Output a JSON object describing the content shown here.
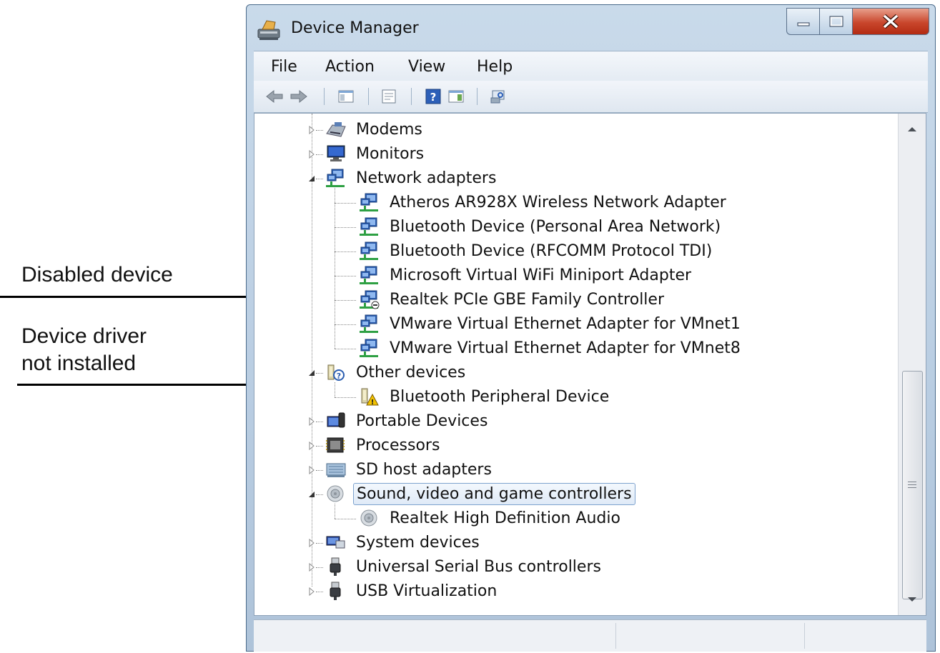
{
  "annotations": {
    "disabled_device": "Disabled device",
    "driver_not_installed": "Device driver\nnot installed"
  },
  "window": {
    "title": "Device Manager",
    "menu": [
      "File",
      "Action",
      "View",
      "Help"
    ],
    "toolbar_icons": [
      "back-icon",
      "forward-icon",
      "show-hide-console-tree-icon",
      "properties-icon",
      "help-icon",
      "action-pane-icon",
      "scan-hardware-icon"
    ]
  },
  "tree": [
    {
      "label": "Modems",
      "icon": "modem-icon",
      "expanded": false,
      "level": 0
    },
    {
      "label": "Monitors",
      "icon": "monitor-icon",
      "expanded": false,
      "level": 0
    },
    {
      "label": "Network adapters",
      "icon": "network-adapter-icon",
      "expanded": true,
      "level": 0
    },
    {
      "label": "Atheros AR928X Wireless Network Adapter",
      "icon": "network-adapter-icon",
      "level": 1
    },
    {
      "label": "Bluetooth Device (Personal Area Network)",
      "icon": "network-adapter-icon",
      "level": 1
    },
    {
      "label": "Bluetooth Device (RFCOMM Protocol TDI)",
      "icon": "network-adapter-icon",
      "level": 1
    },
    {
      "label": "Microsoft Virtual WiFi Miniport Adapter",
      "icon": "network-adapter-icon",
      "level": 1
    },
    {
      "label": "Realtek PCIe GBE Family Controller",
      "icon": "network-adapter-disabled-icon",
      "level": 1
    },
    {
      "label": "VMware Virtual Ethernet Adapter for VMnet1",
      "icon": "network-adapter-icon",
      "level": 1
    },
    {
      "label": "VMware Virtual Ethernet Adapter for VMnet8",
      "icon": "network-adapter-icon",
      "level": 1
    },
    {
      "label": "Other devices",
      "icon": "unknown-device-icon",
      "expanded": true,
      "level": 0
    },
    {
      "label": "Bluetooth Peripheral Device",
      "icon": "warning-device-icon",
      "level": 1
    },
    {
      "label": "Portable Devices",
      "icon": "portable-device-icon",
      "expanded": false,
      "level": 0
    },
    {
      "label": "Processors",
      "icon": "processor-icon",
      "expanded": false,
      "level": 0
    },
    {
      "label": "SD host adapters",
      "icon": "sd-adapter-icon",
      "expanded": false,
      "level": 0
    },
    {
      "label": "Sound, video and game controllers",
      "icon": "speaker-icon",
      "expanded": true,
      "level": 0,
      "selected": true
    },
    {
      "label": "Realtek High Definition Audio",
      "icon": "speaker-icon",
      "level": 1
    },
    {
      "label": "System devices",
      "icon": "system-device-icon",
      "expanded": false,
      "level": 0
    },
    {
      "label": "Universal Serial Bus controllers",
      "icon": "usb-icon",
      "expanded": false,
      "level": 0
    },
    {
      "label": "USB Virtualization",
      "icon": "usb-icon",
      "expanded": false,
      "level": 0
    }
  ],
  "colors": {
    "network_green": "#2ea043",
    "network_blue": "#2a5db0",
    "selection_border": "#7da2ce",
    "warning_yellow": "#f2c200",
    "close_red": "#c9462c"
  }
}
